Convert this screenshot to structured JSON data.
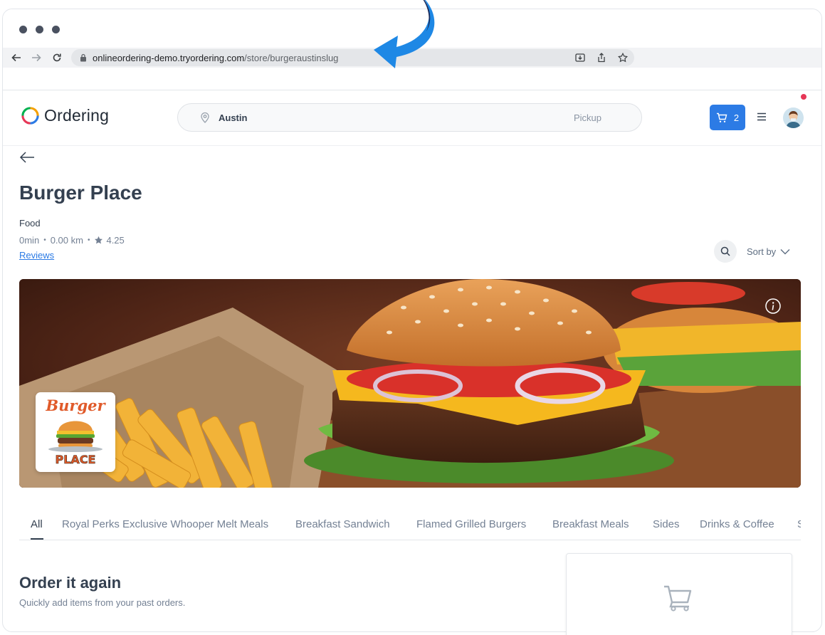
{
  "browser": {
    "url_host": "onlineordering-demo.tryordering.com",
    "url_path": "/store/burgeraustinslug"
  },
  "header": {
    "logo_text": "Ordering",
    "location": "Austin",
    "order_type": "Pickup",
    "cart_count": "2"
  },
  "store": {
    "name": "Burger Place",
    "category": "Food",
    "delivery_time": "0min",
    "distance": "0.00 km",
    "rating": "4.25",
    "reviews_label": "Reviews",
    "sort_label": "Sort by"
  },
  "logo_art": {
    "top": "Burger",
    "bottom": "PLACE"
  },
  "tabs": [
    {
      "label": "All"
    },
    {
      "label": "Royal Perks Exclusive Whooper Melt Meals"
    },
    {
      "label": "Breakfast Sandwich"
    },
    {
      "label": "Flamed Grilled Burgers"
    },
    {
      "label": "Breakfast Meals"
    },
    {
      "label": "Sides"
    },
    {
      "label": "Drinks & Coffee"
    },
    {
      "label": "S"
    }
  ],
  "order_again": {
    "title": "Order it again",
    "subtitle": "Quickly add items from your past orders."
  },
  "colors": {
    "primary": "#2c7be5",
    "text": "#344050",
    "muted": "#748194",
    "notification": "#e63757"
  }
}
